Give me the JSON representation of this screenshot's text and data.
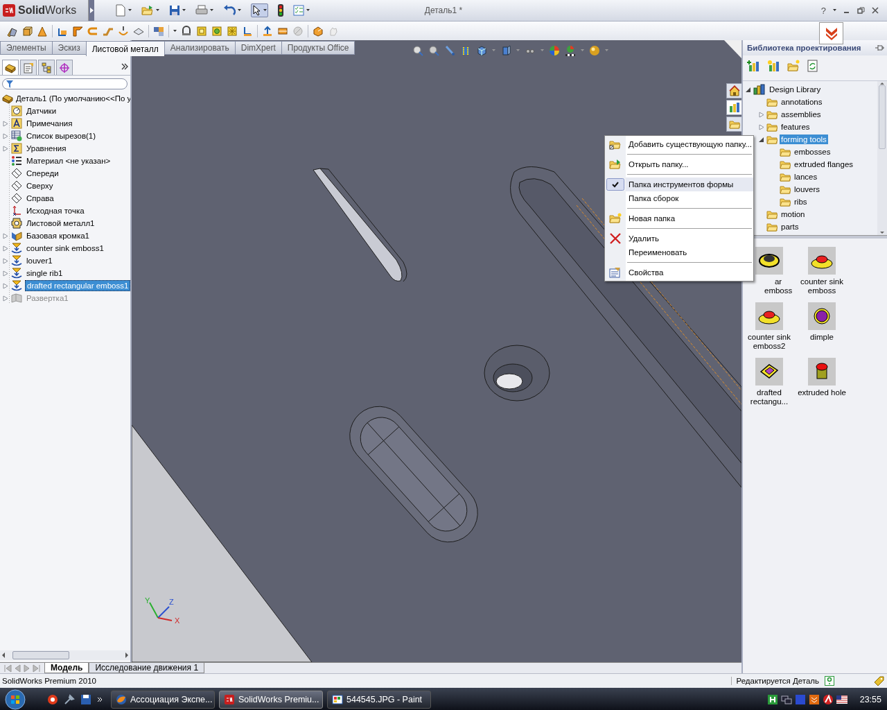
{
  "app": {
    "logo": "**Solid**Works",
    "title": "Деталь1 *",
    "help": "?"
  },
  "command_tabs": [
    {
      "label": "Элементы",
      "selected": false
    },
    {
      "label": "Эскиз",
      "selected": false
    },
    {
      "label": "Листовой металл",
      "selected": true
    },
    {
      "label": "Анализировать",
      "selected": false
    },
    {
      "label": "DimXpert",
      "selected": false
    },
    {
      "label": "Продукты Office",
      "selected": false
    }
  ],
  "feature_tree": {
    "root": "Деталь1  (По умолчанию<<По у",
    "items": [
      {
        "label": "Датчики",
        "kind": "sensor",
        "expandable": false,
        "selected": false,
        "suppressed": false
      },
      {
        "label": "Примечания",
        "kind": "note",
        "expandable": true,
        "selected": false,
        "suppressed": false
      },
      {
        "label": "Список вырезов(1)",
        "kind": "table",
        "expandable": true,
        "selected": false,
        "suppressed": false
      },
      {
        "label": "Уравнения",
        "kind": "equation",
        "expandable": true,
        "selected": false,
        "suppressed": false
      },
      {
        "label": "Материал <не указан>",
        "kind": "material",
        "expandable": false,
        "selected": false,
        "suppressed": false
      },
      {
        "label": "Спереди",
        "kind": "plane",
        "expandable": false,
        "selected": false,
        "suppressed": false
      },
      {
        "label": "Сверху",
        "kind": "plane",
        "expandable": false,
        "selected": false,
        "suppressed": false
      },
      {
        "label": "Справа",
        "kind": "plane",
        "expandable": false,
        "selected": false,
        "suppressed": false
      },
      {
        "label": "Исходная точка",
        "kind": "origin",
        "expandable": false,
        "selected": false,
        "suppressed": false
      },
      {
        "label": "Листовой металл1",
        "kind": "sheet",
        "expandable": false,
        "selected": false,
        "suppressed": false
      },
      {
        "label": "Базовая кромка1",
        "kind": "flange",
        "expandable": true,
        "selected": false,
        "suppressed": false
      },
      {
        "label": "counter sink emboss1",
        "kind": "forming",
        "expandable": true,
        "selected": false,
        "suppressed": false
      },
      {
        "label": "louver1",
        "kind": "forming",
        "expandable": true,
        "selected": false,
        "suppressed": false
      },
      {
        "label": "single rib1",
        "kind": "forming",
        "expandable": true,
        "selected": false,
        "suppressed": false
      },
      {
        "label": "drafted rectangular emboss1",
        "kind": "forming",
        "expandable": true,
        "selected": true,
        "suppressed": false
      },
      {
        "label": "Развертка1",
        "kind": "flat",
        "expandable": true,
        "selected": false,
        "suppressed": true
      }
    ]
  },
  "triad": [
    "X",
    "Y",
    "Z"
  ],
  "design_library": {
    "title": "Библиотека проектирования",
    "tree": [
      {
        "label": "Design Library",
        "kind": "library",
        "expandable": true,
        "selected": false,
        "children": [
          {
            "label": "annotations",
            "kind": "folder",
            "expandable": false,
            "selected": false
          },
          {
            "label": "assemblies",
            "kind": "folder",
            "expandable": true,
            "selected": false
          },
          {
            "label": "features",
            "kind": "folder",
            "expandable": true,
            "selected": false
          },
          {
            "label": "forming tools",
            "kind": "folder",
            "expandable": true,
            "selected": true,
            "children": [
              {
                "label": "embosses",
                "kind": "folder",
                "expandable": false,
                "selected": false
              },
              {
                "label": "extruded flanges",
                "kind": "folder",
                "expandable": false,
                "selected": false
              },
              {
                "label": "lances",
                "kind": "folder",
                "expandable": false,
                "selected": false
              },
              {
                "label": "louvers",
                "kind": "folder",
                "expandable": false,
                "selected": false
              },
              {
                "label": "ribs",
                "kind": "folder",
                "expandable": false,
                "selected": false
              }
            ]
          },
          {
            "label": "motion",
            "kind": "folder",
            "expandable": false,
            "selected": false
          },
          {
            "label": "parts",
            "kind": "folder",
            "expandable": false,
            "selected": false
          }
        ]
      }
    ],
    "items": [
      {
        "label": "ar emboss",
        "kind": "ring"
      },
      {
        "label": "counter sink emboss",
        "kind": "countersink"
      },
      {
        "label": "counter sink emboss2",
        "kind": "countersink"
      },
      {
        "label": "dimple",
        "kind": "dimple"
      },
      {
        "label": "drafted rectangu...",
        "kind": "rectangular"
      },
      {
        "label": "extruded hole",
        "kind": "cylinder"
      }
    ]
  },
  "context_menu": {
    "groups": [
      [
        {
          "label": "Добавить существующую папку...",
          "kind": "add-folder",
          "checked": false
        }
      ],
      [
        {
          "label": "Открыть папку...",
          "kind": "open-folder",
          "checked": false
        }
      ],
      [
        {
          "label": "Папка инструментов формы",
          "kind": "plain",
          "checked": true
        },
        {
          "label": "Папка сборок",
          "kind": "plain",
          "checked": false
        }
      ],
      [
        {
          "label": "Новая папка",
          "kind": "new-folder",
          "checked": false
        }
      ],
      [
        {
          "label": "Удалить",
          "kind": "delete",
          "checked": false
        },
        {
          "label": "Переименовать",
          "kind": "plain",
          "checked": false
        }
      ],
      [
        {
          "label": "Свойства",
          "kind": "properties",
          "checked": false
        }
      ]
    ]
  },
  "bottom_tabs": [
    {
      "label": "Модель",
      "selected": true
    },
    {
      "label": "Исследование движения 1",
      "selected": false
    }
  ],
  "status_bar": {
    "product": "SolidWorks Premium 2010",
    "state": "Редактируется Деталь"
  },
  "taskbar": {
    "tasks": [
      {
        "label": "Ассоциация Экспе...",
        "kind": "browser",
        "selected": false
      },
      {
        "label": "SolidWorks Premiu...",
        "kind": "solidworks",
        "selected": true
      },
      {
        "label": "544545.JPG - Paint",
        "kind": "paint",
        "selected": false
      }
    ],
    "clock": "23:55"
  }
}
